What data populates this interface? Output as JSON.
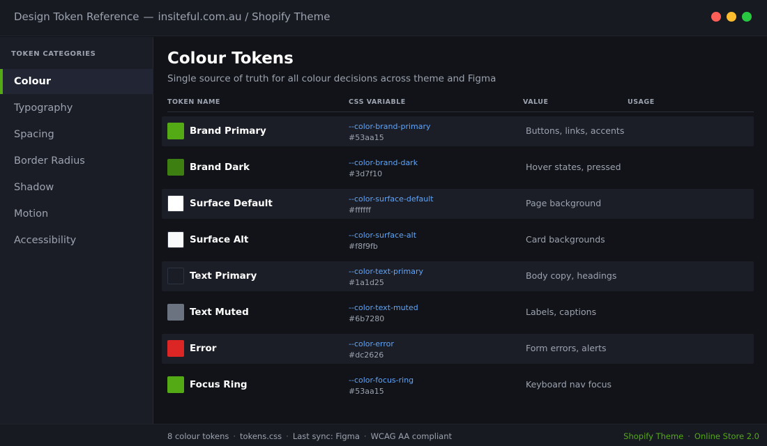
{
  "window": {
    "title": "Design Token Reference",
    "separator": "—",
    "subtitle": "insiteful.com.au / Shopify Theme",
    "controls": [
      {
        "name": "close",
        "color": "#ff5f57"
      },
      {
        "name": "minimize",
        "color": "#febc2e"
      },
      {
        "name": "maximize",
        "color": "#28c840"
      }
    ]
  },
  "sidebar": {
    "heading": "TOKEN CATEGORIES",
    "items": [
      {
        "label": "Colour",
        "active": true
      },
      {
        "label": "Typography",
        "active": false
      },
      {
        "label": "Spacing",
        "active": false
      },
      {
        "label": "Border Radius",
        "active": false
      },
      {
        "label": "Shadow",
        "active": false
      },
      {
        "label": "Motion",
        "active": false
      },
      {
        "label": "Accessibility",
        "active": false
      }
    ]
  },
  "main": {
    "title": "Colour Tokens",
    "subtitle": "Single source of truth for all colour decisions across theme and Figma",
    "columns": {
      "name": "TOKEN NAME",
      "css": "CSS VARIABLE",
      "value": "VALUE",
      "usage": "USAGE"
    },
    "tokens": [
      {
        "name": "Brand Primary",
        "css_var": "--color-brand-primary",
        "hex": "#53aa15",
        "usage": "Buttons, links, accents"
      },
      {
        "name": "Brand Dark",
        "css_var": "--color-brand-dark",
        "hex": "#3d7f10",
        "usage": "Hover states, pressed"
      },
      {
        "name": "Surface Default",
        "css_var": "--color-surface-default",
        "hex": "#ffffff",
        "usage": "Page background"
      },
      {
        "name": "Surface Alt",
        "css_var": "--color-surface-alt",
        "hex": "#f8f9fb",
        "usage": "Card backgrounds"
      },
      {
        "name": "Text Primary",
        "css_var": "--color-text-primary",
        "hex": "#1a1d25",
        "usage": "Body copy, headings"
      },
      {
        "name": "Text Muted",
        "css_var": "--color-text-muted",
        "hex": "#6b7280",
        "usage": "Labels, captions"
      },
      {
        "name": "Error",
        "css_var": "--color-error",
        "hex": "#dc2626",
        "usage": "Form errors, alerts"
      },
      {
        "name": "Focus Ring",
        "css_var": "--color-focus-ring",
        "hex": "#53aa15",
        "usage": "Keyboard nav focus"
      }
    ]
  },
  "statusbar": {
    "left": [
      "8 colour tokens",
      "tokens.css",
      "Last sync: Figma",
      "WCAG AA compliant"
    ],
    "separator": "·",
    "right": [
      "Shopify Theme",
      "Online Store 2.0"
    ]
  }
}
